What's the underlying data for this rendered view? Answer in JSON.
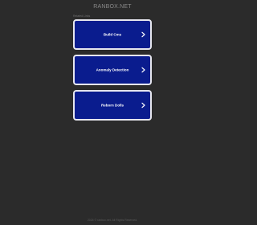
{
  "header": {
    "site_title": "RANBOX.NET",
    "related_label": "Related Links"
  },
  "links": [
    {
      "label": "Build Cms",
      "icon": "chevron-right-icon"
    },
    {
      "label": "Anomaly Detection",
      "icon": "chevron-right-icon"
    },
    {
      "label": "Reborn Dolls",
      "icon": "chevron-right-icon"
    }
  ],
  "footer": {
    "text": "2024 © ranbox.net. All Rights Reserved."
  },
  "colors": {
    "background": "#2b2b2b",
    "link_box": "#0a1c8e",
    "link_border": "#e6e6ee",
    "link_text": "#ffffff"
  }
}
